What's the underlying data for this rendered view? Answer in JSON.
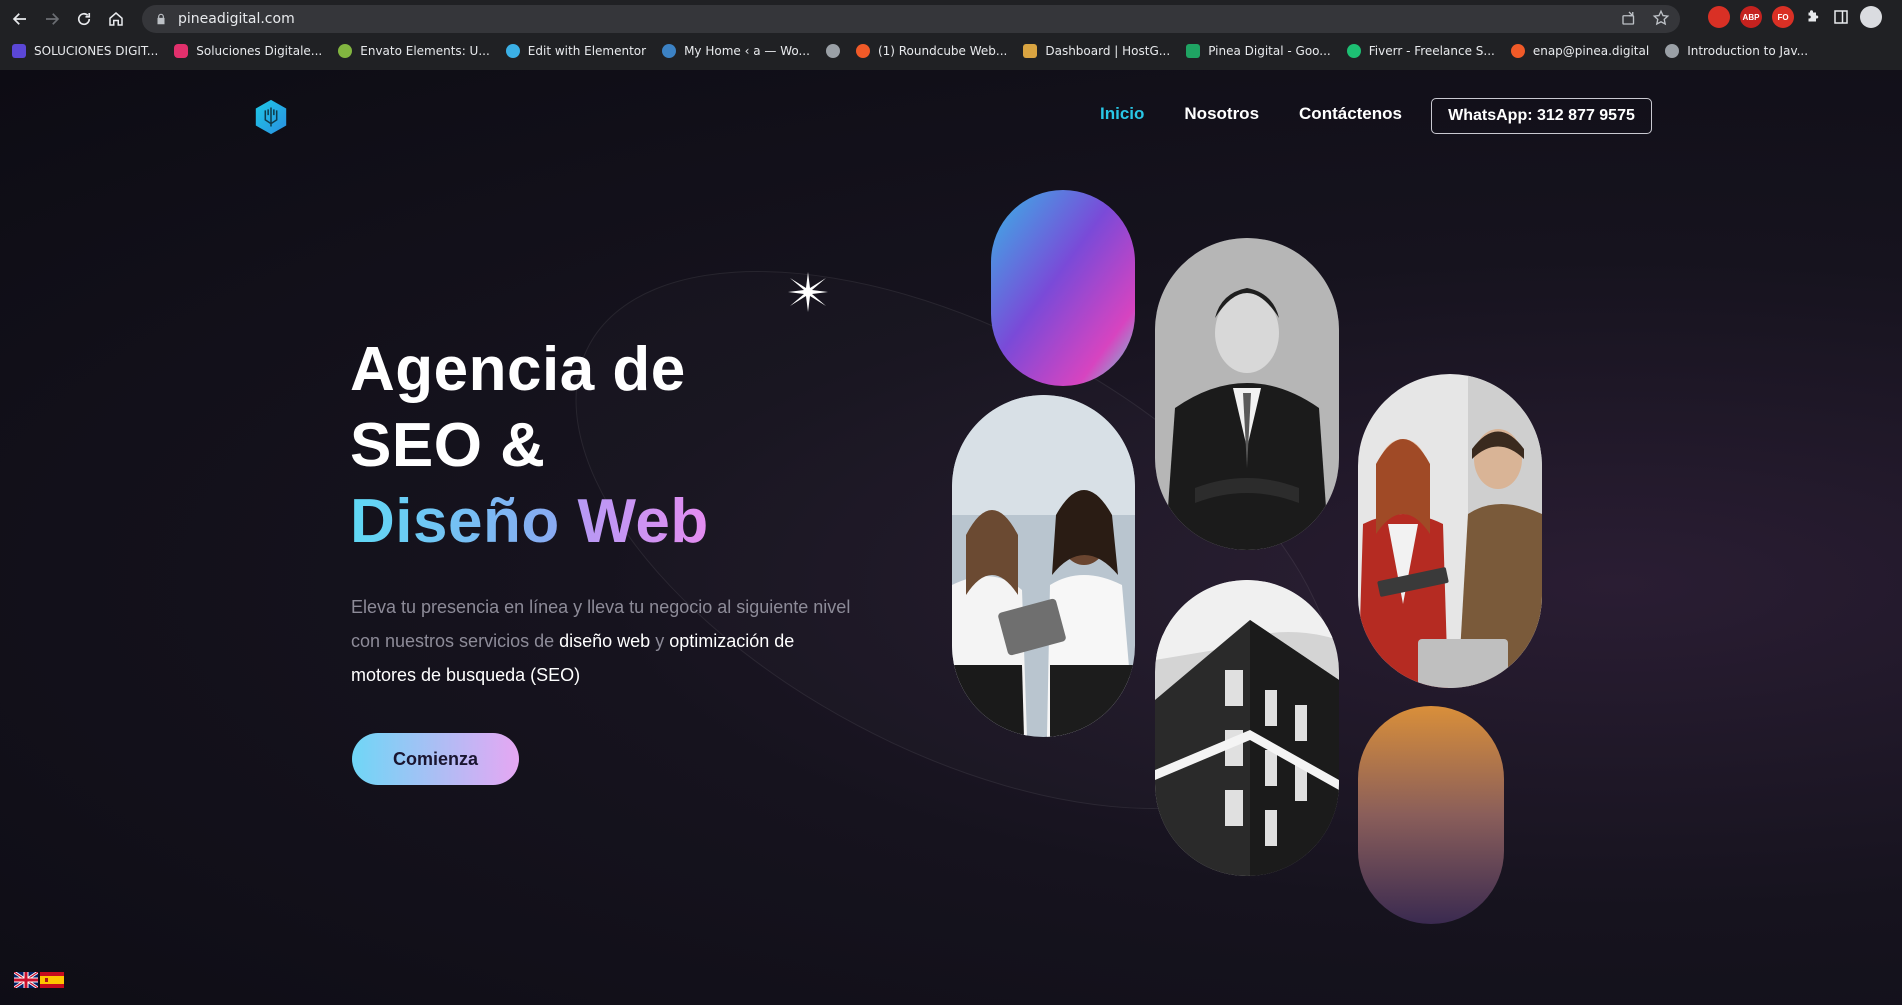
{
  "browser": {
    "url": "pineadigital.com",
    "bookmarks": [
      {
        "label": "SOLUCIONES DIGIT...",
        "color": "#5b47d6"
      },
      {
        "label": "Soluciones Digitale...",
        "color": "#e1306c"
      },
      {
        "label": "Envato Elements: U...",
        "color": "#82b540"
      },
      {
        "label": "Edit with Elementor",
        "color": "#3bb0e6"
      },
      {
        "label": "My Home ‹ a — Wo...",
        "color": "#3c82c4"
      },
      {
        "label": "",
        "color": "#9aa0a6"
      },
      {
        "label": "(1) Roundcube Web...",
        "color": "#f05a28"
      },
      {
        "label": "Dashboard | HostG...",
        "color": "#d9a441"
      },
      {
        "label": "Pinea Digital - Goo...",
        "color": "#1fa463"
      },
      {
        "label": "Fiverr - Freelance S...",
        "color": "#1dbf73"
      },
      {
        "label": "enap@pinea.digital",
        "color": "#f05a28"
      },
      {
        "label": "Introduction to Jav...",
        "color": "#9aa0a6"
      }
    ],
    "extensions": [
      {
        "label": "",
        "color": "#d93025"
      },
      {
        "label": "ABP",
        "color": "#c5221f"
      },
      {
        "label": "FO",
        "color": "#d93025"
      }
    ]
  },
  "site": {
    "nav": {
      "items": [
        {
          "label": "Inicio",
          "active": true
        },
        {
          "label": "Nosotros",
          "active": false
        },
        {
          "label": "Contáctenos",
          "active": false
        }
      ],
      "whatsapp": "WhatsApp: 312 877 9575"
    },
    "hero": {
      "title_line1": "Agencia de",
      "title_line2": "SEO &",
      "title_word1": "Diseño",
      "title_word2": "Web",
      "desc_part1": "Eleva tu presencia en línea y lleva tu negocio al siguiente nivel con nuestros servicios de",
      "desc_hl1": "diseño web",
      "desc_part2": "y",
      "desc_hl2": "optimización de motores de busqueda (SEO)",
      "cta": "Comienza"
    }
  },
  "colors": {
    "accent_cyan": "#29c7e6",
    "gradient_start": "#6fd6f6",
    "gradient_end": "#e6a7f3",
    "background": "#0f0e17"
  }
}
